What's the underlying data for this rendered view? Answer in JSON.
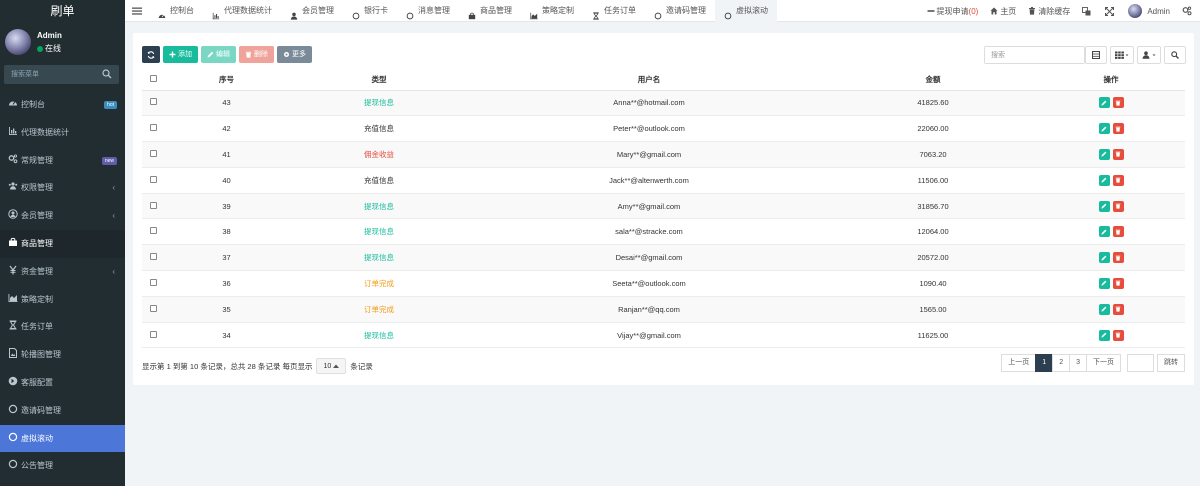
{
  "brand": "刷单",
  "user": {
    "name": "Admin",
    "status": "在线"
  },
  "sidebar": {
    "search_placeholder": "搜索菜单",
    "items": [
      {
        "label": "控制台",
        "icon": "dashboard-icon",
        "badge": "hot"
      },
      {
        "label": "代理数据统计",
        "icon": "bar-chart-icon"
      },
      {
        "label": "常规管理",
        "icon": "cogs-icon",
        "badge": "new"
      },
      {
        "label": "权限管理",
        "icon": "group-icon",
        "chevron": "‹"
      },
      {
        "label": "会员管理",
        "icon": "user-circle-icon",
        "chevron": "‹"
      },
      {
        "label": "商品管理",
        "icon": "shopping-bag-icon"
      },
      {
        "label": "资金管理",
        "icon": "yen-icon",
        "chevron": "‹"
      },
      {
        "label": "策略定制",
        "icon": "area-chart-icon"
      },
      {
        "label": "任务订单",
        "icon": "hourglass-icon"
      },
      {
        "label": "轮播图管理",
        "icon": "file-image-icon"
      },
      {
        "label": "客服配置",
        "icon": "arrow-circle-icon"
      },
      {
        "label": "邀请码管理",
        "icon": "circle-icon"
      },
      {
        "label": "虚拟滚动",
        "icon": "circle-icon"
      },
      {
        "label": "公告管理",
        "icon": "circle-icon"
      }
    ]
  },
  "tabs": [
    {
      "label": "控制台",
      "icon": "dashboard-icon"
    },
    {
      "label": "代理数据统计",
      "icon": "bar-chart-icon"
    },
    {
      "label": "会员管理",
      "icon": "user-icon"
    },
    {
      "label": "银行卡",
      "icon": "circle-icon"
    },
    {
      "label": "消息管理",
      "icon": "circle-icon"
    },
    {
      "label": "商品管理",
      "icon": "shopping-bag-icon"
    },
    {
      "label": "策略定制",
      "icon": "area-chart-icon"
    },
    {
      "label": "任务订单",
      "icon": "hourglass-icon"
    },
    {
      "label": "邀请码管理",
      "icon": "circle-icon"
    },
    {
      "label": "虚拟滚动",
      "icon": "circle-icon"
    }
  ],
  "topright": {
    "withdraw_label": "提现申请",
    "withdraw_count": "(0)",
    "home_label": "主页",
    "clear_cache_label": "清除缓存",
    "admin_label": "Admin"
  },
  "toolbar": {
    "add_label": "添加",
    "edit_label": "编辑",
    "delete_label": "删除",
    "more_label": "更多",
    "search_placeholder": "搜索"
  },
  "table": {
    "headers": [
      "序号",
      "类型",
      "用户名",
      "金额",
      "操作"
    ],
    "rows": [
      {
        "id": "43",
        "type": "提现信息",
        "type_color": "#18bc9c",
        "user": "Anna**@hotmail.com",
        "amount": "41825.60"
      },
      {
        "id": "42",
        "type": "充值信息",
        "type_color": "#333333",
        "user": "Peter**@outlook.com",
        "amount": "22060.00"
      },
      {
        "id": "41",
        "type": "佣金收益",
        "type_color": "#e74c3c",
        "user": "Mary**@gmail.com",
        "amount": "7063.20"
      },
      {
        "id": "40",
        "type": "充值信息",
        "type_color": "#333333",
        "user": "Jack**@altenwerth.com",
        "amount": "11506.00"
      },
      {
        "id": "39",
        "type": "提现信息",
        "type_color": "#18bc9c",
        "user": "Amy**@gmail.com",
        "amount": "31856.70"
      },
      {
        "id": "38",
        "type": "提现信息",
        "type_color": "#18bc9c",
        "user": "sala**@stracke.com",
        "amount": "12064.00"
      },
      {
        "id": "37",
        "type": "提现信息",
        "type_color": "#18bc9c",
        "user": "Desai**@gmail.com",
        "amount": "20572.00"
      },
      {
        "id": "36",
        "type": "订单完成",
        "type_color": "#f39c12",
        "user": "Seeta**@outlook.com",
        "amount": "1090.40"
      },
      {
        "id": "35",
        "type": "订单完成",
        "type_color": "#f39c12",
        "user": "Ranjan**@qq.com",
        "amount": "1565.00"
      },
      {
        "id": "34",
        "type": "提现信息",
        "type_color": "#18bc9c",
        "user": "Vijay**@gmail.com",
        "amount": "11625.00"
      }
    ]
  },
  "footer": {
    "info_prefix": "显示第 1 到第 10 条记录，总共 28 条记录 每页显示",
    "page_size": "10",
    "info_suffix": "条记录"
  },
  "pager": {
    "prev": "上一页",
    "pages": [
      "1",
      "2",
      "3"
    ],
    "next": "下一页",
    "go": "跳转"
  }
}
